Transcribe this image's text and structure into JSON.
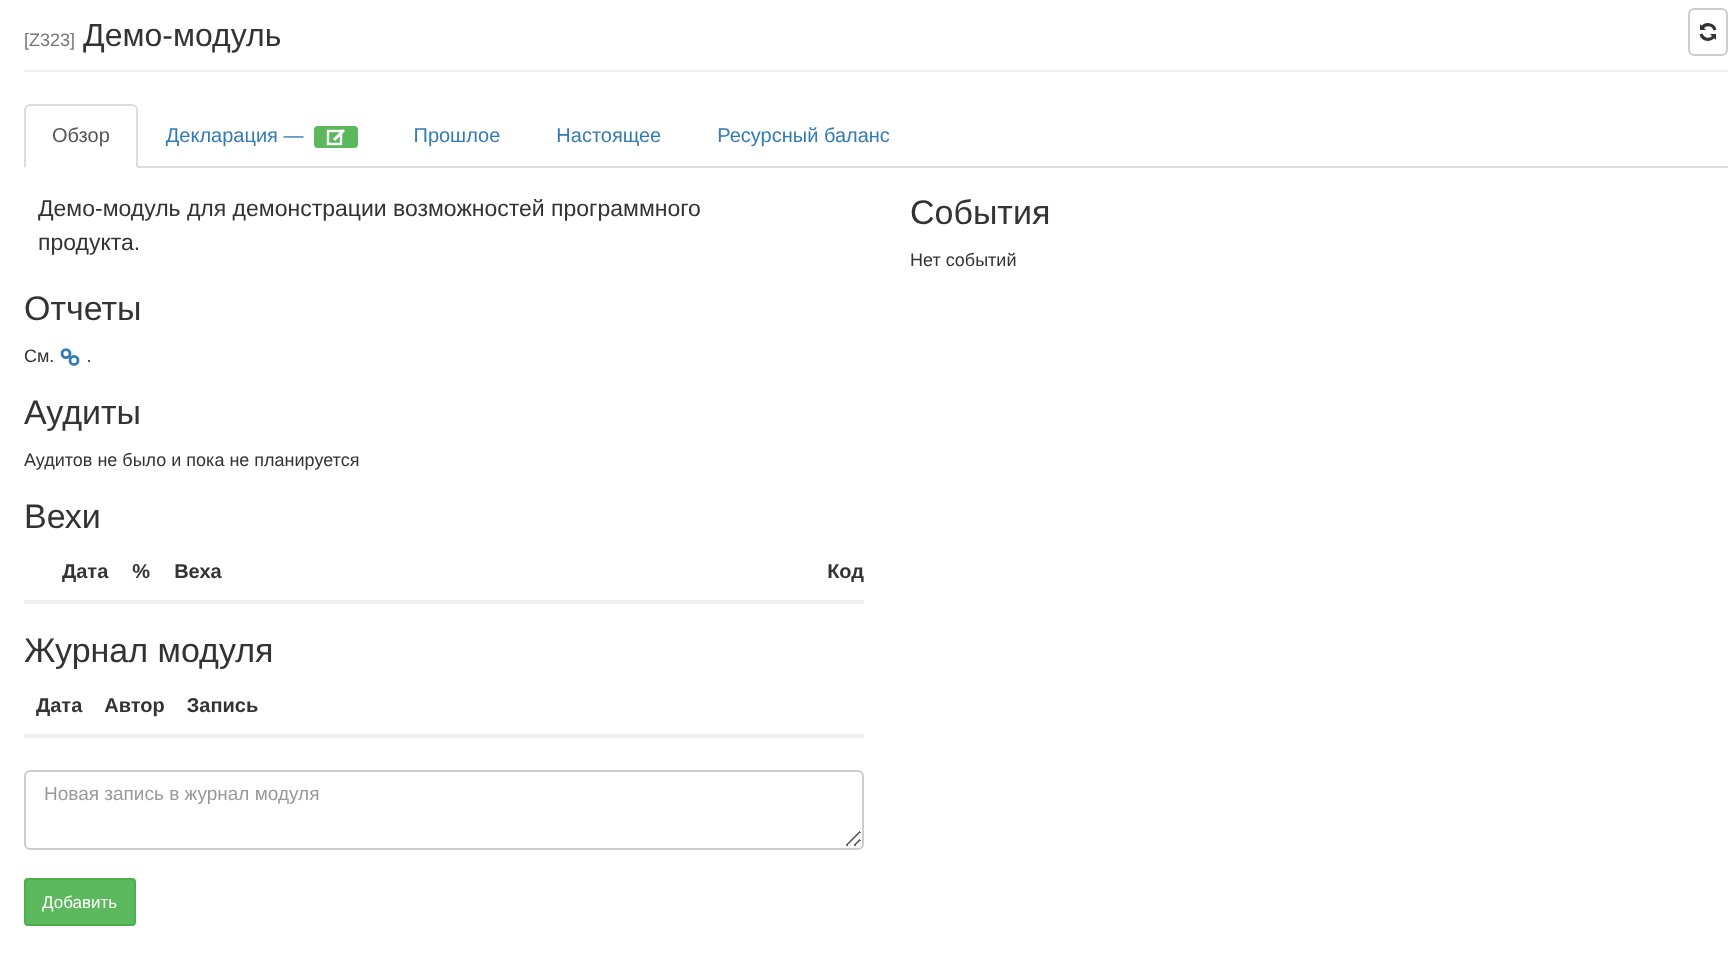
{
  "header": {
    "code": "[Z323]",
    "title": "Демо-модуль"
  },
  "tabs": [
    {
      "label": "Обзор",
      "selected": true,
      "badge": false
    },
    {
      "label": "Декларация —",
      "selected": false,
      "badge": true
    },
    {
      "label": "Прошлое",
      "selected": false,
      "badge": false
    },
    {
      "label": "Настоящее",
      "selected": false,
      "badge": false
    },
    {
      "label": "Ресурсный баланс",
      "selected": false,
      "badge": false
    }
  ],
  "description": "Демо-модуль для демонстрации возможностей программного продукта.",
  "reports": {
    "heading": "Отчеты",
    "text": "См.",
    "end": "."
  },
  "audits": {
    "heading": "Аудиты",
    "text": "Аудитов не было и пока не планируется"
  },
  "milestones": {
    "heading": "Вехи",
    "columns": [
      "Дата",
      "%",
      "Веха",
      "Код"
    ]
  },
  "journal": {
    "heading": "Журнал модуля",
    "columns": [
      "Дата",
      "Автор",
      "Запись"
    ],
    "placeholder": "Новая запись в журнал модуля",
    "button": "Добавить"
  },
  "events": {
    "heading": "События",
    "text": "Нет событий"
  }
}
